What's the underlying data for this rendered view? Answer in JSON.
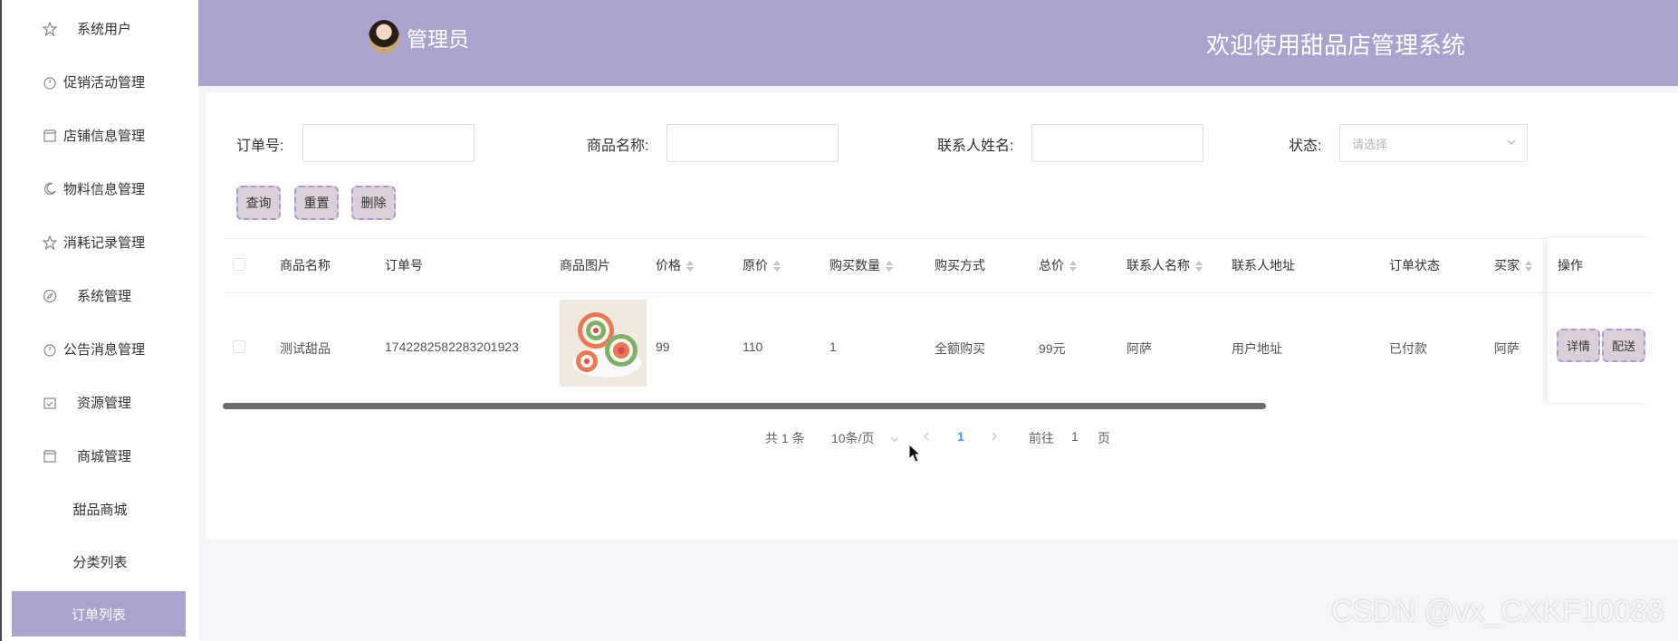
{
  "sidebar": {
    "items": [
      {
        "label": "系统用户",
        "icon": "star-icon"
      },
      {
        "label": "促销活动管理",
        "icon": "timer-icon"
      },
      {
        "label": "店铺信息管理",
        "icon": "shop-icon"
      },
      {
        "label": "物料信息管理",
        "icon": "moon-icon"
      },
      {
        "label": "消耗记录管理",
        "icon": "star-icon"
      },
      {
        "label": "系统管理",
        "icon": "compass-icon"
      },
      {
        "label": "公告消息管理",
        "icon": "timer-icon"
      },
      {
        "label": "资源管理",
        "icon": "calendar-check-icon"
      },
      {
        "label": "商城管理",
        "icon": "shop-icon"
      }
    ],
    "sub_items": [
      {
        "label": "甜品商城"
      },
      {
        "label": "分类列表"
      },
      {
        "label": "订单列表"
      }
    ]
  },
  "header": {
    "user": "管理员",
    "welcome": "欢迎使用甜品店管理系统"
  },
  "filters": {
    "order_no_label": "订单号:",
    "product_name_label": "商品名称:",
    "contact_name_label": "联系人姓名:",
    "status_label": "状态:",
    "status_placeholder": "请选择"
  },
  "actions": {
    "query": "查询",
    "reset": "重置",
    "delete": "删除"
  },
  "table": {
    "headers": {
      "product_name": "商品名称",
      "order_no": "订单号",
      "product_image": "商品图片",
      "price": "价格",
      "original_price": "原价",
      "quantity": "购买数量",
      "payment_method": "购买方式",
      "total": "总价",
      "contact_name": "联系人名称",
      "contact_address": "联系人地址",
      "order_status": "订单状态",
      "buyer": "买家",
      "operations": "操作"
    },
    "rows": [
      {
        "product_name": "测试甜品",
        "order_no": "1742282582283201923",
        "price": "99",
        "original_price": "110",
        "quantity": "1",
        "payment_method": "全额购买",
        "total": "99元",
        "contact_name": "阿萨",
        "contact_address": "用户地址",
        "order_status": "已付款",
        "buyer": "阿萨",
        "detail_button": "详情",
        "ship_button": "配送"
      }
    ]
  },
  "pagination": {
    "total": "共 1 条",
    "page_size": "10条/页",
    "current_page": "1",
    "goto_label": "前往",
    "goto_value": "1",
    "page_suffix": "页"
  },
  "watermark": "CSDN @vx_CXKF10088",
  "colors": {
    "accent": "#aaa2cf",
    "button_bg": "#ddcfd9",
    "button_border": "#a69dcf",
    "page_link": "#409eff"
  }
}
